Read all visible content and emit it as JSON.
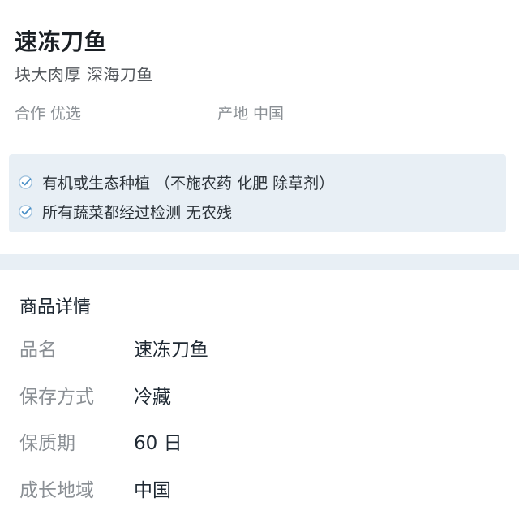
{
  "product": {
    "title": "速冻刀鱼",
    "subtitle": "块大肉厚  深海刀鱼",
    "cooperation": "合作  优选",
    "origin": "产地  中国"
  },
  "promises": {
    "icon": "check-badge-icon",
    "accent_color": "#4a90c8",
    "items": [
      {
        "text": "有机或生态种植  （不施农药  化肥  除草剂）"
      },
      {
        "text": "所有蔬菜都经过检测  无农残"
      }
    ]
  },
  "details": {
    "heading": "商品详情",
    "rows": [
      {
        "label": "品名",
        "value": "速冻刀鱼"
      },
      {
        "label": "保存方式",
        "value": "冷藏"
      },
      {
        "label": "保质期",
        "value": "60 日"
      },
      {
        "label": "成长地域",
        "value": "中国"
      }
    ]
  },
  "colors": {
    "band_background": "#e8eff5",
    "muted_text": "#8a8f94"
  }
}
